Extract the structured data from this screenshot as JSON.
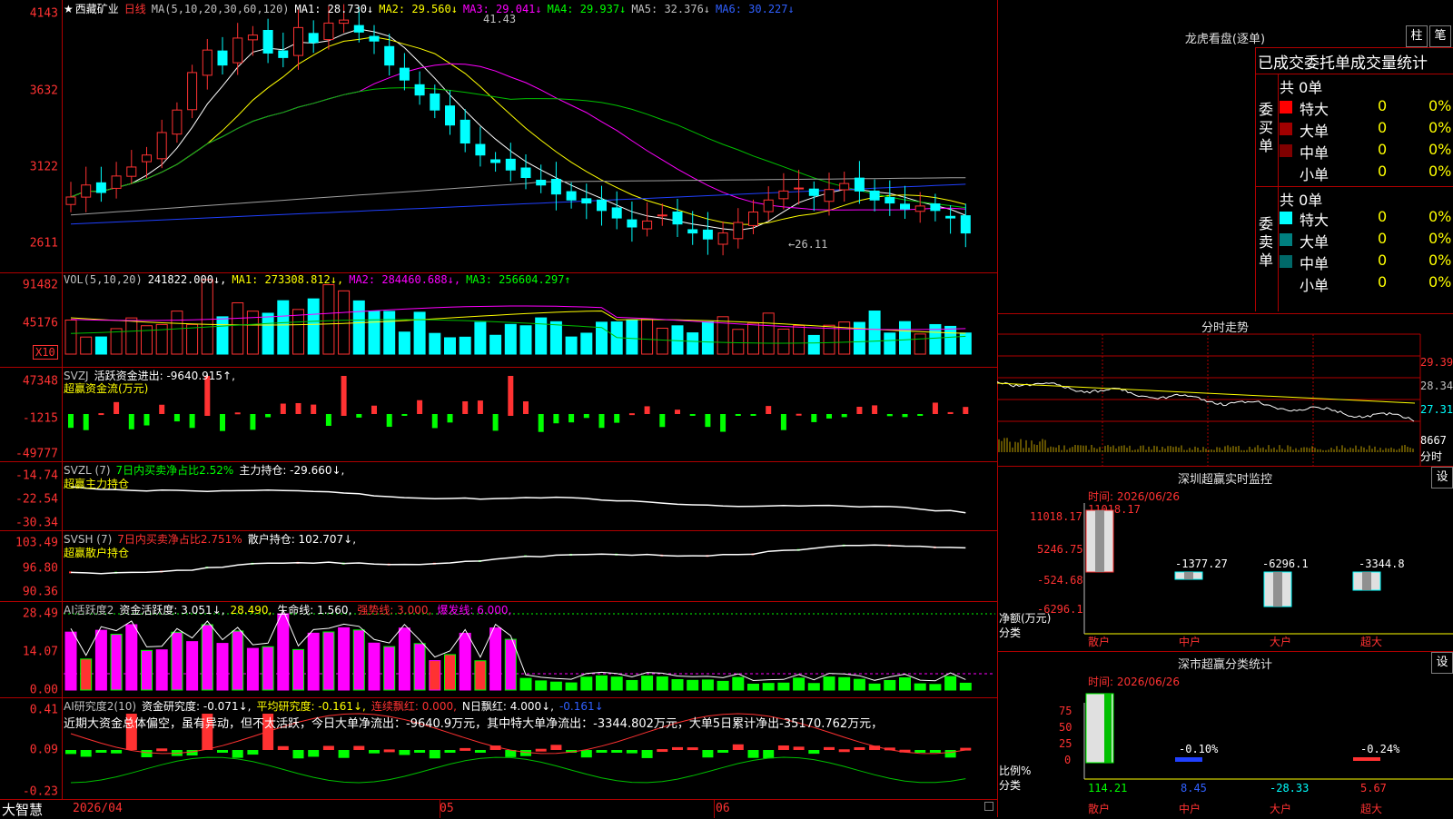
{
  "stock": {
    "name": "西藏矿业",
    "period": "日线",
    "star": "★"
  },
  "ma_header": {
    "label": "MA(5,10,20,30,60,120)",
    "ma1": "MA1: 28.730↓",
    "ma2": "MA2: 29.560↓",
    "ma3": "MA3: 29.041↓",
    "ma4": "MA4: 29.937↓",
    "ma5": "MA5: 32.376↓",
    "ma6": "MA6: 30.227↓"
  },
  "price_axis": [
    "4143",
    "3632",
    "3122",
    "2611"
  ],
  "price_annotations": {
    "high": "41.43",
    "low": "←26.11"
  },
  "vol_header": {
    "label": "VOL(5,10,20)",
    "value": "241822.000↓,",
    "ma1": "MA1: 273308.812↓,",
    "ma2": "MA2: 284460.688↓,",
    "ma3": "MA3: 256604.297↑"
  },
  "vol_axis": [
    "91482",
    "45176"
  ],
  "vol_unit": "X10",
  "svzj": {
    "label": "SVZJ",
    "t1": "活跃资金进出: -9640.915↑,",
    "t2": "超赢资金流(万元)",
    "axis": [
      "47348",
      "-1215",
      "-49777"
    ]
  },
  "svzl": {
    "label": "SVZL (7)",
    "t1": "7日内买卖净占比2.52%",
    "t2": "主力持仓: -29.660↓,",
    "t3": "超赢主力持仓",
    "axis": [
      "-14.74",
      "-22.54",
      "-30.34"
    ]
  },
  "svsh": {
    "label": "SVSH (7)",
    "t1": "7日内买卖净占比2.751%",
    "t2": "散户持仓: 102.707↓,",
    "t3": "超赢散户持仓",
    "axis": [
      "103.49",
      "96.80",
      "90.36"
    ]
  },
  "ai_active": {
    "label": "AI活跃度2",
    "t1": "资金活跃度: 3.051↓,",
    "t2": "28.490,",
    "t3": "生命线: 1.560,",
    "t4": "强势线: 3.000,",
    "t5": "爆发线: 6.000,",
    "axis": [
      "28.49",
      "14.07",
      "0.00"
    ]
  },
  "ai_research": {
    "label": "AI研究度2(10)",
    "t1": "资金研究度: -0.071↓,",
    "t2": "平均研究度: -0.161↓,",
    "t3": "连续飘红: 0.000,",
    "t4": "N日飘红: 4.000↓,",
    "t5": "-0.161↓",
    "comment": "近期大资金总体偏空，虽有异动，但不太活跃，今日大单净流出：-9640.9万元，其中特大单净流出：-3344.802万元，大单5日累计净出-35170.762万元，",
    "axis": [
      "0.41",
      "0.09",
      "-0.23"
    ]
  },
  "date_axis": [
    "2026/04",
    "05",
    "06"
  ],
  "brand": "大智慧",
  "dragon_tiger": {
    "title": "龙虎看盘(逐单)",
    "btn1": "柱",
    "btn2": "笔",
    "subtitle": "已成交委托单成交量统计",
    "buy": {
      "side": "委买单",
      "count": "共 0单",
      "rows": [
        {
          "label": "特大",
          "n": "0",
          "pct": "0%",
          "color": "#ff0000"
        },
        {
          "label": "大单",
          "n": "0",
          "pct": "0%",
          "color": "#a00000"
        },
        {
          "label": "中单",
          "n": "0",
          "pct": "0%",
          "color": "#800000"
        },
        {
          "label": "小单",
          "n": "0",
          "pct": "0%",
          "color": "#000000"
        }
      ]
    },
    "sell": {
      "side": "委卖单",
      "count": "共 0单",
      "rows": [
        {
          "label": "特大",
          "n": "0",
          "pct": "0%",
          "color": "#00ffff"
        },
        {
          "label": "大单",
          "n": "0",
          "pct": "0%",
          "color": "#008080"
        },
        {
          "label": "中单",
          "n": "0",
          "pct": "0%",
          "color": "#006868"
        },
        {
          "label": "小单",
          "n": "0",
          "pct": "0%",
          "color": "#000000"
        }
      ]
    }
  },
  "intraday": {
    "title": "分时走势",
    "axis": [
      "29.39",
      "28.34",
      "27.31"
    ],
    "vol_label": "8667",
    "vol_unit": "分时"
  },
  "sz_monitor": {
    "title": "深圳超赢实时监控",
    "settings": "设",
    "time": "时间: 2026/06/26",
    "top_value": "11018.17",
    "axis": [
      "11018.17",
      "5246.75",
      "-524.68",
      "-6296.1"
    ],
    "ylabel": "净额(万元)",
    "xlabel": "分类",
    "cats": [
      "散户",
      "中户",
      "大户",
      "超大"
    ],
    "values": [
      "11018.17",
      "-1377.27",
      "-6296.1",
      "-3344.8"
    ]
  },
  "sz_class": {
    "title": "深市超赢分类统计",
    "settings": "设",
    "time": "时间: 2026/06/26",
    "axis": [
      "75",
      "50",
      "25",
      "0"
    ],
    "ylabel": "比例%",
    "xlabel": "分类",
    "cats": [
      "散户",
      "中户",
      "大户",
      "超大"
    ],
    "values": [
      "114.21",
      "8.45",
      "-28.33",
      "5.67"
    ],
    "pct": [
      "-0.10%",
      "-0.24%"
    ]
  }
}
